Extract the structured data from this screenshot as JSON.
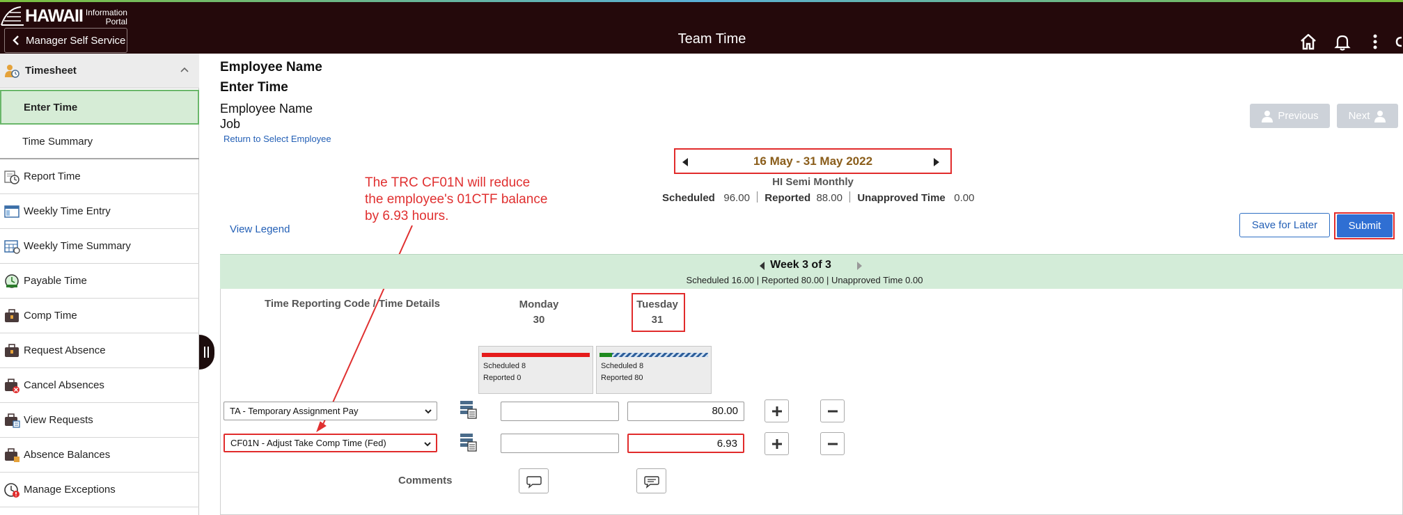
{
  "header": {
    "logo_main": "HAWAII",
    "logo_sub_1": "Information",
    "logo_sub_2": "Portal",
    "back_label": "Manager Self Service",
    "page_title": "Team Time"
  },
  "sidebar": {
    "group_label": "Timesheet",
    "sub_items": [
      "Enter Time",
      "Time Summary"
    ],
    "items": [
      {
        "label": "Report Time",
        "icon": "clock-report-icon"
      },
      {
        "label": "Weekly Time Entry",
        "icon": "calendar-window-icon"
      },
      {
        "label": "Weekly Time Summary",
        "icon": "calendar-grid-icon"
      },
      {
        "label": "Payable Time",
        "icon": "payable-clock-icon"
      },
      {
        "label": "Comp Time",
        "icon": "briefcase-icon"
      },
      {
        "label": "Request Absence",
        "icon": "briefcase-icon"
      },
      {
        "label": "Cancel Absences",
        "icon": "briefcase-cancel-icon"
      },
      {
        "label": "View Requests",
        "icon": "briefcase-view-icon"
      },
      {
        "label": "Absence Balances",
        "icon": "briefcase-balance-icon"
      },
      {
        "label": "Manage Exceptions",
        "icon": "exception-clock-icon"
      }
    ]
  },
  "main": {
    "employee_name_heading": "Employee Name",
    "enter_time_heading": "Enter Time",
    "employee_name": "Employee Name",
    "job": "Job",
    "return_link": "Return to Select Employee",
    "previous_label": "Previous",
    "next_label": "Next",
    "period_label": "16 May - 31 May 2022",
    "period_type": "HI Semi Monthly",
    "summary": {
      "scheduled_label": "Scheduled",
      "scheduled_value": "96.00",
      "reported_label": "Reported",
      "reported_value": "88.00",
      "unapproved_label": "Unapproved Time",
      "unapproved_value": "0.00"
    },
    "annotation_lines": [
      "The TRC CF01N will reduce",
      "the employee's 01CTF balance",
      "by 6.93 hours."
    ],
    "view_legend": "View Legend",
    "save_label": "Save for Later",
    "submit_label": "Submit",
    "week": {
      "title": "Week 3 of 3",
      "summary": "Scheduled  16.00 | Reported  80.00 | Unapproved Time  0.00"
    },
    "column_header": "Time Reporting Code / Time Details",
    "days": [
      {
        "name": "Monday",
        "date": "30",
        "scheduled": "Scheduled 8",
        "reported": "Reported   0"
      },
      {
        "name": "Tuesday",
        "date": "31",
        "scheduled": "Scheduled 8",
        "reported": "Reported   80"
      }
    ],
    "rows": [
      {
        "trc": "TA - Temporary Assignment Pay",
        "monday": "",
        "tuesday": "80.00"
      },
      {
        "trc": "CF01N - Adjust Take Comp Time (Fed)",
        "monday": "",
        "tuesday": "6.93"
      }
    ],
    "comments_label": "Comments"
  },
  "colors": {
    "header_bg": "#24090b",
    "highlight_red": "#e12b2b",
    "submit_blue": "#2f6fd3",
    "week_band": "#d3ecd8",
    "period_text": "#8a5d1a"
  }
}
